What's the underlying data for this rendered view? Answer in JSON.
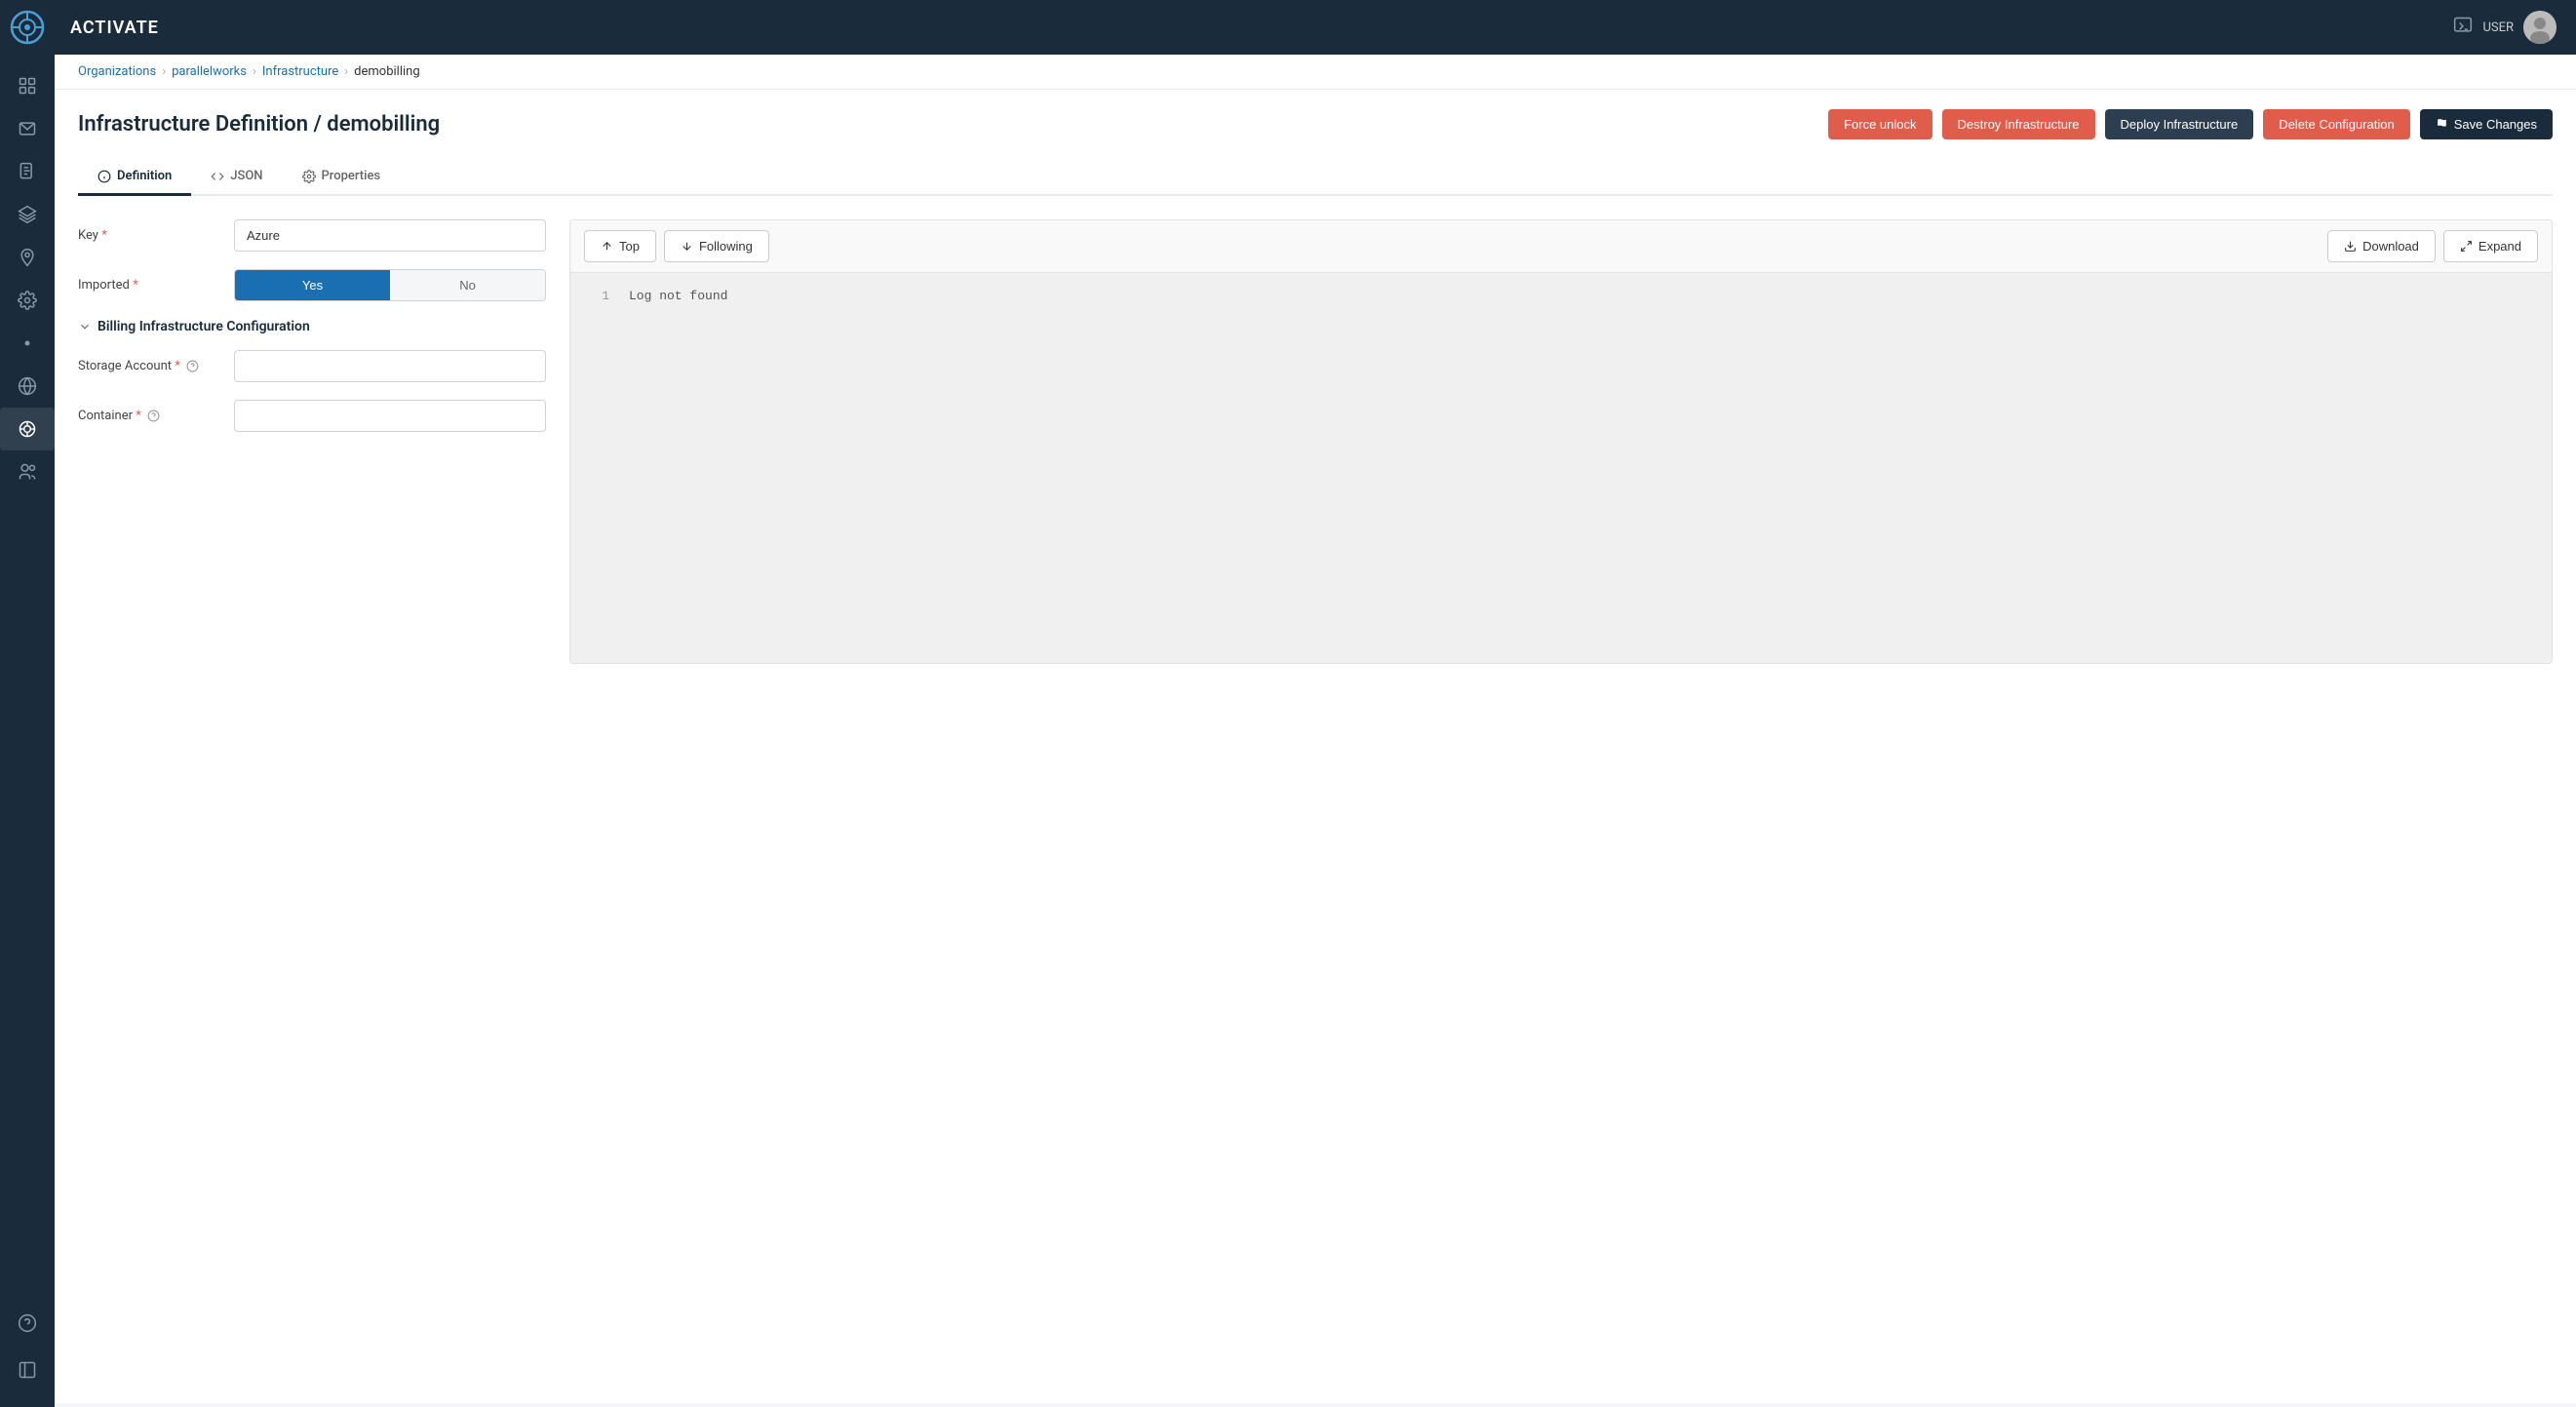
{
  "app": {
    "name": "ACTIVATE",
    "user": "USER"
  },
  "breadcrumb": {
    "items": [
      {
        "label": "Organizations",
        "current": false
      },
      {
        "label": "parallelworks",
        "current": false
      },
      {
        "label": "Infrastructure",
        "current": false
      },
      {
        "label": "demobilling",
        "current": true
      }
    ]
  },
  "page": {
    "title": "Infrastructure Definition / demobilling"
  },
  "buttons": {
    "force_unlock": "Force unlock",
    "destroy": "Destroy Infrastructure",
    "deploy": "Deploy Infrastructure",
    "delete": "Delete Configuration",
    "save": "Save Changes"
  },
  "tabs": [
    {
      "id": "definition",
      "label": "Definition",
      "active": true
    },
    {
      "id": "json",
      "label": "JSON",
      "active": false
    },
    {
      "id": "properties",
      "label": "Properties",
      "active": false
    }
  ],
  "form": {
    "key_label": "Key",
    "key_value": "Azure",
    "imported_label": "Imported",
    "toggle_yes": "Yes",
    "toggle_no": "No",
    "section_title": "Billing Infrastructure Configuration",
    "storage_account_label": "Storage Account",
    "storage_account_value": "",
    "container_label": "Container",
    "container_value": ""
  },
  "log": {
    "top_label": "Top",
    "following_label": "Following",
    "download_label": "Download",
    "expand_label": "Expand",
    "line_number": "1",
    "log_text": "Log not found"
  },
  "sidebar": {
    "items": [
      {
        "id": "dashboard",
        "icon": "home"
      },
      {
        "id": "inbox",
        "icon": "inbox"
      },
      {
        "id": "docs",
        "icon": "file"
      },
      {
        "id": "layers",
        "icon": "layers"
      },
      {
        "id": "location",
        "icon": "map-pin"
      },
      {
        "id": "settings-gear",
        "icon": "gear"
      },
      {
        "id": "dot1",
        "icon": "dot"
      },
      {
        "id": "globe",
        "icon": "globe"
      },
      {
        "id": "infra-active",
        "icon": "network",
        "active": true
      },
      {
        "id": "team",
        "icon": "team"
      }
    ],
    "bottom": [
      {
        "id": "help",
        "icon": "help"
      },
      {
        "id": "collapse",
        "icon": "sidebar"
      }
    ]
  }
}
